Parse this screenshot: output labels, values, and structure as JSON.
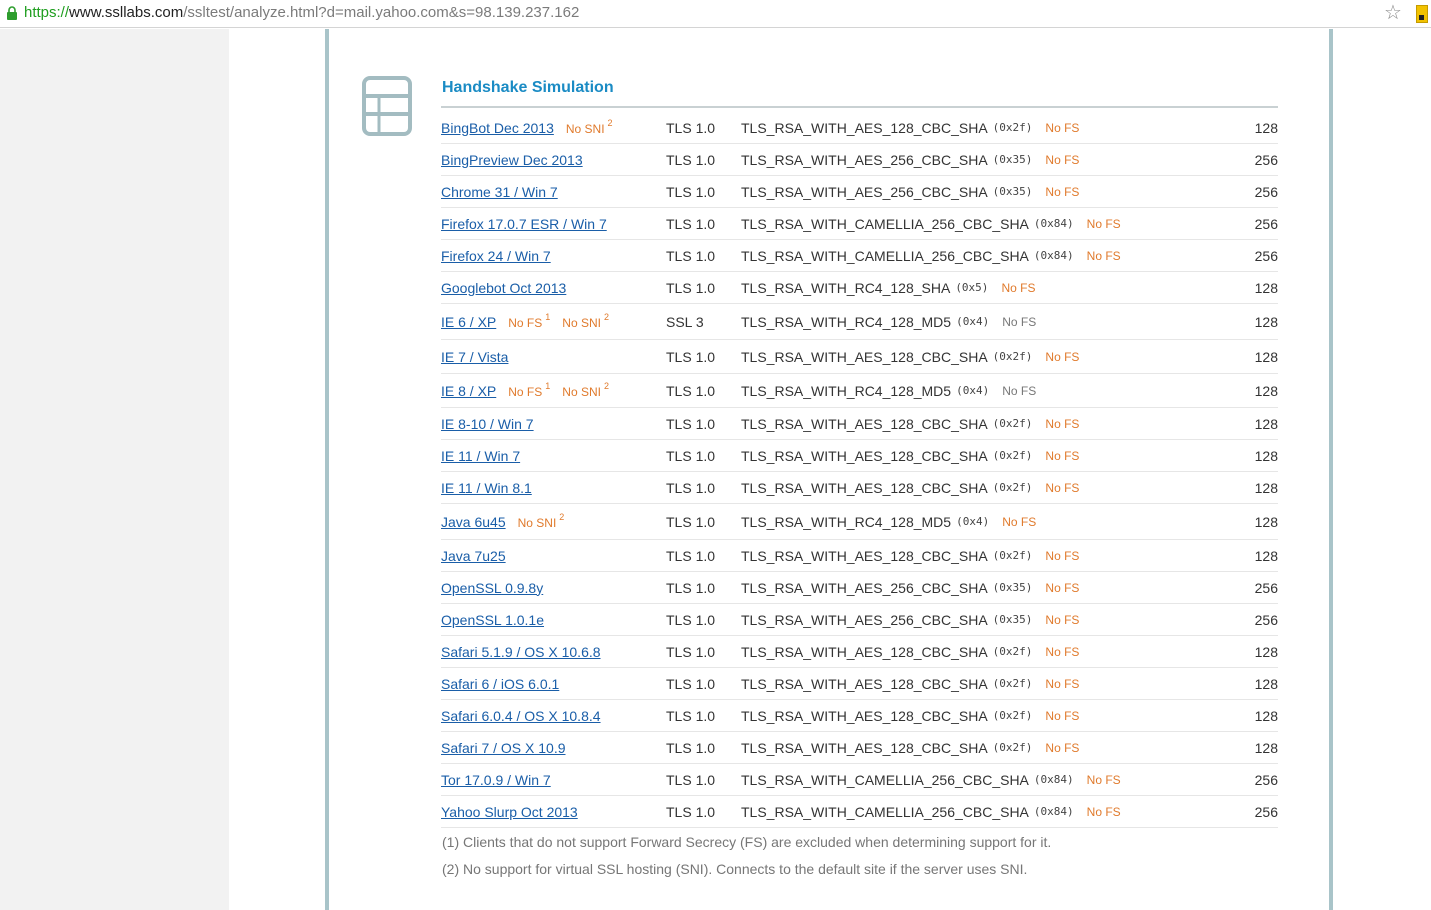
{
  "browser": {
    "url_scheme": "https://",
    "url_host": "www.ssllabs.com",
    "url_path": "/ssltest/analyze.html?d=mail.yahoo.com&s=98.139.237.162"
  },
  "section": {
    "title": "Handshake Simulation"
  },
  "rows": [
    {
      "client": "BingBot Dec 2013",
      "flags": [
        {
          "text": "No SNI",
          "note": "2"
        }
      ],
      "protocol": "TLS 1.0",
      "suite": "TLS_RSA_WITH_AES_128_CBC_SHA",
      "code": "(0x2f)",
      "fs": "No FS",
      "fs_warn": true,
      "bits": "128"
    },
    {
      "client": "BingPreview Dec 2013",
      "flags": [],
      "protocol": "TLS 1.0",
      "suite": "TLS_RSA_WITH_AES_256_CBC_SHA",
      "code": "(0x35)",
      "fs": "No FS",
      "fs_warn": true,
      "bits": "256"
    },
    {
      "client": "Chrome 31 / Win 7",
      "flags": [],
      "protocol": "TLS 1.0",
      "suite": "TLS_RSA_WITH_AES_256_CBC_SHA",
      "code": "(0x35)",
      "fs": "No FS",
      "fs_warn": true,
      "bits": "256"
    },
    {
      "client": "Firefox 17.0.7 ESR / Win 7",
      "flags": [],
      "protocol": "TLS 1.0",
      "suite": "TLS_RSA_WITH_CAMELLIA_256_CBC_SHA",
      "code": "(0x84)",
      "fs": "No FS",
      "fs_warn": true,
      "bits": "256"
    },
    {
      "client": "Firefox 24 / Win 7",
      "flags": [],
      "protocol": "TLS 1.0",
      "suite": "TLS_RSA_WITH_CAMELLIA_256_CBC_SHA",
      "code": "(0x84)",
      "fs": "No FS",
      "fs_warn": true,
      "bits": "256"
    },
    {
      "client": "Googlebot Oct 2013",
      "flags": [],
      "protocol": "TLS 1.0",
      "suite": "TLS_RSA_WITH_RC4_128_SHA",
      "code": "(0x5)",
      "fs": "No FS",
      "fs_warn": true,
      "bits": "128"
    },
    {
      "client": "IE 6 / XP",
      "flags": [
        {
          "text": "No FS",
          "note": "1"
        },
        {
          "text": "No SNI",
          "note": "2"
        }
      ],
      "protocol": "SSL 3",
      "suite": "TLS_RSA_WITH_RC4_128_MD5",
      "code": "(0x4)",
      "fs": "No FS",
      "fs_warn": false,
      "bits": "128"
    },
    {
      "client": "IE 7 / Vista",
      "flags": [],
      "protocol": "TLS 1.0",
      "suite": "TLS_RSA_WITH_AES_128_CBC_SHA",
      "code": "(0x2f)",
      "fs": "No FS",
      "fs_warn": true,
      "bits": "128"
    },
    {
      "client": "IE 8 / XP",
      "flags": [
        {
          "text": "No FS",
          "note": "1"
        },
        {
          "text": "No SNI",
          "note": "2"
        }
      ],
      "protocol": "TLS 1.0",
      "suite": "TLS_RSA_WITH_RC4_128_MD5",
      "code": "(0x4)",
      "fs": "No FS",
      "fs_warn": false,
      "bits": "128"
    },
    {
      "client": "IE 8-10 / Win 7",
      "flags": [],
      "protocol": "TLS 1.0",
      "suite": "TLS_RSA_WITH_AES_128_CBC_SHA",
      "code": "(0x2f)",
      "fs": "No FS",
      "fs_warn": true,
      "bits": "128"
    },
    {
      "client": "IE 11 / Win 7",
      "flags": [],
      "protocol": "TLS 1.0",
      "suite": "TLS_RSA_WITH_AES_128_CBC_SHA",
      "code": "(0x2f)",
      "fs": "No FS",
      "fs_warn": true,
      "bits": "128"
    },
    {
      "client": "IE 11 / Win 8.1",
      "flags": [],
      "protocol": "TLS 1.0",
      "suite": "TLS_RSA_WITH_AES_128_CBC_SHA",
      "code": "(0x2f)",
      "fs": "No FS",
      "fs_warn": true,
      "bits": "128"
    },
    {
      "client": "Java 6u45",
      "flags": [
        {
          "text": "No SNI",
          "note": "2"
        }
      ],
      "protocol": "TLS 1.0",
      "suite": "TLS_RSA_WITH_RC4_128_MD5",
      "code": "(0x4)",
      "fs": "No FS",
      "fs_warn": true,
      "bits": "128"
    },
    {
      "client": "Java 7u25",
      "flags": [],
      "protocol": "TLS 1.0",
      "suite": "TLS_RSA_WITH_AES_128_CBC_SHA",
      "code": "(0x2f)",
      "fs": "No FS",
      "fs_warn": true,
      "bits": "128"
    },
    {
      "client": "OpenSSL 0.9.8y",
      "flags": [],
      "protocol": "TLS 1.0",
      "suite": "TLS_RSA_WITH_AES_256_CBC_SHA",
      "code": "(0x35)",
      "fs": "No FS",
      "fs_warn": true,
      "bits": "256"
    },
    {
      "client": "OpenSSL 1.0.1e",
      "flags": [],
      "protocol": "TLS 1.0",
      "suite": "TLS_RSA_WITH_AES_256_CBC_SHA",
      "code": "(0x35)",
      "fs": "No FS",
      "fs_warn": true,
      "bits": "256"
    },
    {
      "client": "Safari 5.1.9 / OS X 10.6.8",
      "flags": [],
      "protocol": "TLS 1.0",
      "suite": "TLS_RSA_WITH_AES_128_CBC_SHA",
      "code": "(0x2f)",
      "fs": "No FS",
      "fs_warn": true,
      "bits": "128"
    },
    {
      "client": "Safari 6 / iOS 6.0.1",
      "flags": [],
      "protocol": "TLS 1.0",
      "suite": "TLS_RSA_WITH_AES_128_CBC_SHA",
      "code": "(0x2f)",
      "fs": "No FS",
      "fs_warn": true,
      "bits": "128"
    },
    {
      "client": "Safari 6.0.4 / OS X 10.8.4",
      "flags": [],
      "protocol": "TLS 1.0",
      "suite": "TLS_RSA_WITH_AES_128_CBC_SHA",
      "code": "(0x2f)",
      "fs": "No FS",
      "fs_warn": true,
      "bits": "128"
    },
    {
      "client": "Safari 7 / OS X 10.9",
      "flags": [],
      "protocol": "TLS 1.0",
      "suite": "TLS_RSA_WITH_AES_128_CBC_SHA",
      "code": "(0x2f)",
      "fs": "No FS",
      "fs_warn": true,
      "bits": "128"
    },
    {
      "client": "Tor 17.0.9 / Win 7",
      "flags": [],
      "protocol": "TLS 1.0",
      "suite": "TLS_RSA_WITH_CAMELLIA_256_CBC_SHA",
      "code": "(0x84)",
      "fs": "No FS",
      "fs_warn": true,
      "bits": "256"
    },
    {
      "client": "Yahoo Slurp Oct 2013",
      "flags": [],
      "protocol": "TLS 1.0",
      "suite": "TLS_RSA_WITH_CAMELLIA_256_CBC_SHA",
      "code": "(0x84)",
      "fs": "No FS",
      "fs_warn": true,
      "bits": "256"
    }
  ],
  "footnotes": [
    "(1) Clients that do not support Forward Secrecy (FS) are excluded when determining support for it.",
    "(2) No support for virtual SSL hosting (SNI). Connects to the default site if the server uses SNI."
  ],
  "colors": {
    "title": "#1a8bc4",
    "link": "#1a5ea8",
    "warning": "#e07a2c",
    "card_border": "#a9c4c9"
  },
  "icons": {
    "lock": "lock-icon",
    "star": "bookmark-star-icon",
    "extension": "extension-icon",
    "section": "server-icon"
  }
}
